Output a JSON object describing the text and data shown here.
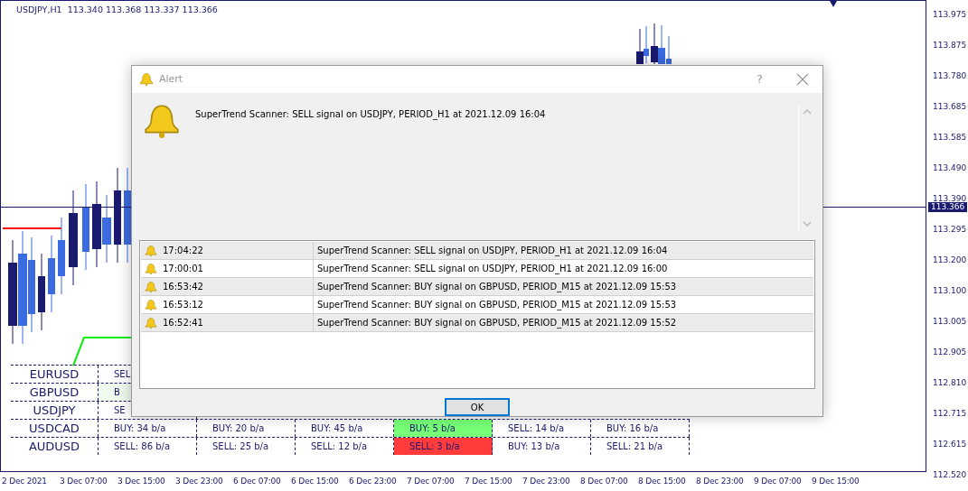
{
  "chart": {
    "header": "USDJPY,H1  113.340 113.368 113.337 113.366",
    "current_price": "113.366",
    "price_axis": [
      "113.975",
      "113.875",
      "113.780",
      "113.685",
      "113.585",
      "113.490",
      "113.390",
      "113.295",
      "113.200",
      "113.100",
      "113.005",
      "112.905",
      "112.810",
      "112.715",
      "112.615",
      "112.520"
    ],
    "time_axis": [
      "2 Dec 2021",
      "3 Dec 07:00",
      "3 Dec 15:00",
      "3 Dec 23:00",
      "6 Dec 07:00",
      "6 Dec 15:00",
      "6 Dec 23:00",
      "7 Dec 07:00",
      "7 Dec 15:00",
      "7 Dec 23:00",
      "8 Dec 07:00",
      "8 Dec 15:00",
      "8 Dec 23:00",
      "9 Dec 07:00",
      "9 Dec 15:00"
    ]
  },
  "scanner": {
    "rows": [
      {
        "symbol": "EURUSD",
        "cells": [
          {
            "text": "SEL"
          }
        ]
      },
      {
        "symbol": "GBPUSD",
        "cells": [
          {
            "text": "B",
            "color": "#eefaee"
          }
        ]
      },
      {
        "symbol": "USDJPY",
        "cells": [
          {
            "text": "SE"
          }
        ]
      },
      {
        "symbol": "USDCAD",
        "cells": [
          {
            "text": "BUY: 34 b/a"
          },
          {
            "text": "BUY: 20 b/a"
          },
          {
            "text": "BUY: 45 b/a"
          },
          {
            "text": "BUY: 5 b/a",
            "color": "#77ff77"
          },
          {
            "text": "SELL: 14 b/a"
          },
          {
            "text": "BUY: 16 b/a"
          }
        ]
      },
      {
        "symbol": "AUDUSD",
        "cells": [
          {
            "text": "SELL: 86 b/a"
          },
          {
            "text": "SELL: 25 b/a"
          },
          {
            "text": "SELL: 12 b/a"
          },
          {
            "text": "SELL: 3 b/a",
            "color": "#ff3b3b"
          },
          {
            "text": "BUY: 13 b/a"
          },
          {
            "text": "SELL: 21 b/a"
          }
        ]
      }
    ]
  },
  "alert": {
    "title": "Alert",
    "help": "?",
    "message": "SuperTrend Scanner: SELL signal on USDJPY, PERIOD_H1 at 2021.12.09 16:04",
    "log": [
      {
        "time": "17:04:22",
        "message": "SuperTrend Scanner: SELL signal on USDJPY, PERIOD_H1 at 2021.12.09 16:04"
      },
      {
        "time": "17:00:01",
        "message": "SuperTrend Scanner: SELL signal on USDJPY, PERIOD_H1 at 2021.12.09 16:00"
      },
      {
        "time": "16:53:42",
        "message": "SuperTrend Scanner: BUY signal on GBPUSD, PERIOD_M15 at 2021.12.09 15:53"
      },
      {
        "time": "16:53:12",
        "message": "SuperTrend Scanner: BUY signal on GBPUSD, PERIOD_M15 at 2021.12.09 15:53"
      },
      {
        "time": "16:52:41",
        "message": "SuperTrend Scanner: BUY signal on GBPUSD, PERIOD_M15 at 2021.12.09 15:52"
      }
    ],
    "ok_button": "OK"
  }
}
